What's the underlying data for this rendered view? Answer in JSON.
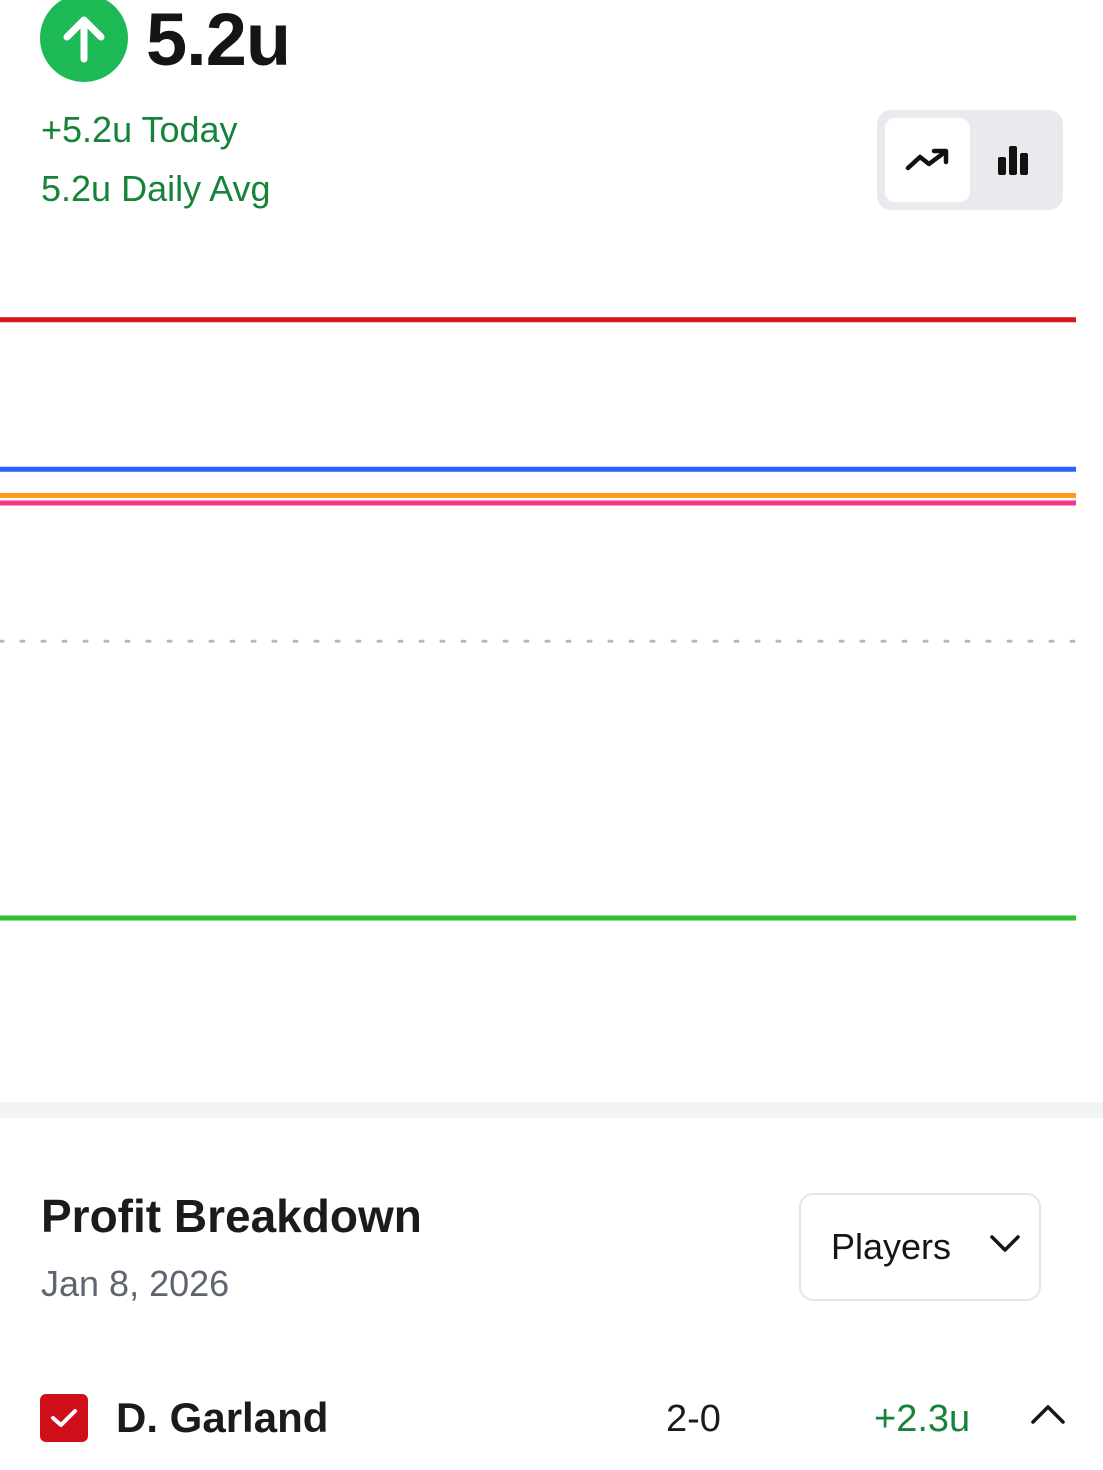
{
  "summary": {
    "total": "5.2u",
    "today": "+5.2u Today",
    "daily_avg": "5.2u Daily Avg",
    "trend_icon": "arrow-up-icon",
    "accent_color": "#1db954",
    "positive_color": "#16833a"
  },
  "chart_toggle": {
    "options": [
      {
        "icon": "line-chart-icon",
        "selected": true
      },
      {
        "icon": "bar-chart-icon",
        "selected": false
      }
    ]
  },
  "chart_data": {
    "type": "line",
    "series": [
      {
        "color": "#d7141d",
        "level": 4.3
      },
      {
        "color": "#2962ff",
        "level": 2.3
      },
      {
        "color": "#ff9a1a",
        "level": 1.95
      },
      {
        "color": "#f0358f",
        "level": 1.85
      },
      {
        "color": "#2dc22d",
        "level": -3.7
      }
    ],
    "zero_line": {
      "value": 0,
      "style": "dotted"
    },
    "ylim": [
      -6.0,
      5.5
    ],
    "grid": false,
    "legend": "none"
  },
  "breakdown": {
    "title": "Profit Breakdown",
    "date": "Jan 8, 2026",
    "group_by": "Players",
    "rows": [
      {
        "checked": true,
        "name": "D. Garland",
        "record": "2-0",
        "profit": "+2.3u",
        "expanded": true
      }
    ]
  }
}
